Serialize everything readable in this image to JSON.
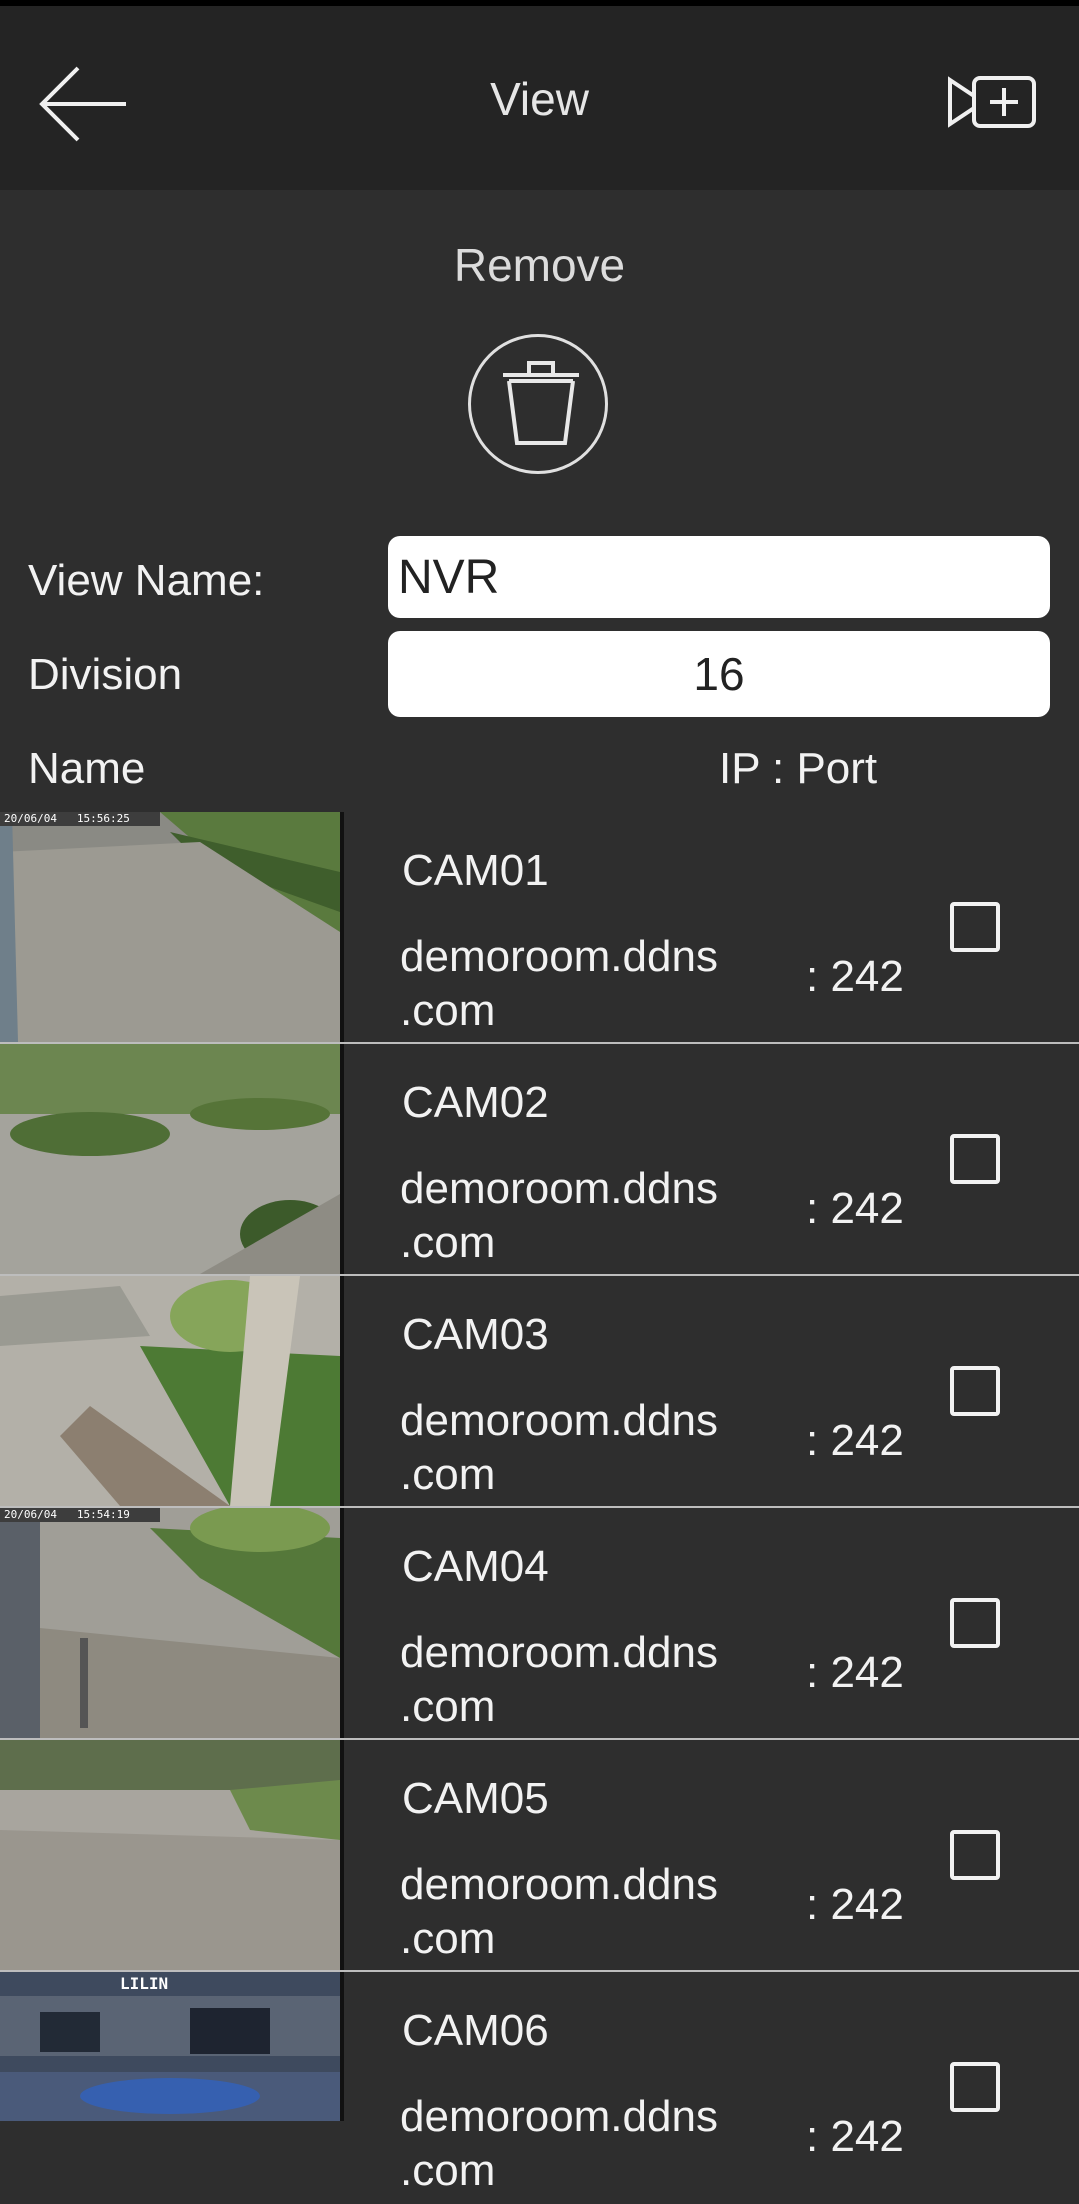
{
  "header": {
    "title": "View",
    "back_icon": "arrow-left-icon",
    "add_icon": "camera-add-icon"
  },
  "remove": {
    "label": "Remove",
    "icon": "trash-icon"
  },
  "form": {
    "view_name_label": "View Name:",
    "view_name_value": "NVR",
    "division_label": "Division",
    "division_value": "16"
  },
  "columns": {
    "name": "Name",
    "ip_port": "IP : Port"
  },
  "cameras": [
    {
      "name": "CAM01",
      "host_line1": "demoroom.ddns",
      "host_line2": ".com",
      "port": ": 242",
      "osd": "20/06/04   15:56:25"
    },
    {
      "name": "CAM02",
      "host_line1": "demoroom.ddns",
      "host_line2": ".com",
      "port": ": 242",
      "osd": ""
    },
    {
      "name": "CAM03",
      "host_line1": "demoroom.ddns",
      "host_line2": ".com",
      "port": ": 242",
      "osd": ""
    },
    {
      "name": "CAM04",
      "host_line1": "demoroom.ddns",
      "host_line2": ".com",
      "port": ": 242",
      "osd": "20/06/04   15:54:19"
    },
    {
      "name": "CAM05",
      "host_line1": "demoroom.ddns",
      "host_line2": ".com",
      "port": ": 242",
      "osd": ""
    },
    {
      "name": "CAM06",
      "host_line1": "demoroom.ddns",
      "host_line2": ".com",
      "port": ": 242",
      "osd": "LILIN"
    }
  ],
  "colors": {
    "background": "#2e2e2e",
    "header": "#242424",
    "text": "#f2f2f2",
    "divider": "#bdbdbd"
  }
}
